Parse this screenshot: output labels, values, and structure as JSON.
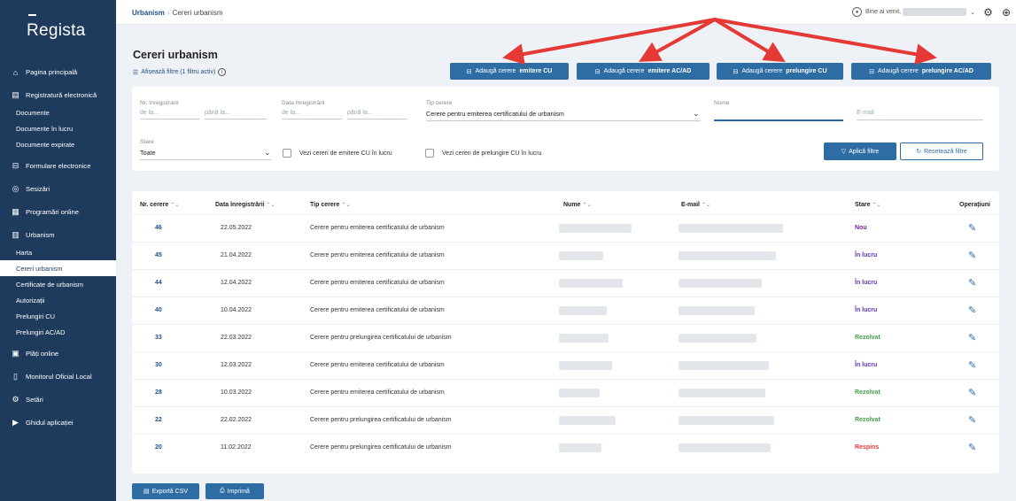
{
  "app": {
    "logo": "Regista"
  },
  "sidebar": {
    "items": [
      {
        "label": "Pagina principală",
        "icon": "home-icon"
      },
      {
        "label": "Registratură electronică",
        "icon": "document-icon"
      },
      {
        "label": "Documente",
        "icon": ""
      },
      {
        "label": "Documente în lucru",
        "icon": ""
      },
      {
        "label": "Documente expirate",
        "icon": ""
      },
      {
        "label": "Formulare electronice",
        "icon": "form-icon"
      },
      {
        "label": "Sesizări",
        "icon": "location-pin-icon"
      },
      {
        "label": "Programări online",
        "icon": "calendar-icon"
      },
      {
        "label": "Urbanism",
        "icon": "building-icon"
      },
      {
        "label": "Harta",
        "icon": ""
      },
      {
        "label": "Cereri urbanism",
        "icon": ""
      },
      {
        "label": "Certificate de urbanism",
        "icon": ""
      },
      {
        "label": "Autorizații",
        "icon": ""
      },
      {
        "label": "Prelungiri CU",
        "icon": ""
      },
      {
        "label": "Prelungiri AC/AD",
        "icon": ""
      },
      {
        "label": "Plăți online",
        "icon": "payment-icon"
      },
      {
        "label": "Monitorul Oficial Local",
        "icon": "monitor-icon"
      },
      {
        "label": "Setări",
        "icon": "settings-icon"
      },
      {
        "label": "Ghidul aplicației",
        "icon": "play-circle-icon"
      }
    ]
  },
  "topbar": {
    "breadcrumb_root": "Urbanism",
    "breadcrumb_current": "Cereri urbanism",
    "greeting": "Bine ai venit,"
  },
  "header": {
    "title": "Cereri urbanism",
    "filter_toggle": "Afișează filtre (1 filtru activ)"
  },
  "actions": {
    "b1_prefix": "Adaugă cerere ",
    "b1_bold": "emitere CU",
    "b2_prefix": "Adaugă cerere ",
    "b2_bold": "emitere AC/AD",
    "b3_prefix": "Adaugă cerere ",
    "b3_bold": "prelungire CU",
    "b4_prefix": "Adaugă cerere ",
    "b4_bold": "prelungire AC/AD"
  },
  "filters": {
    "nr_label": "Nr. înregistrare",
    "nr_from": "de la...",
    "nr_to": "până la...",
    "date_label": "Data înregistrării",
    "date_from": "de la...",
    "date_to": "până la...",
    "type_label": "Tip cerere",
    "type_value": "Cerere pentru emiterea certificatului de urbanism",
    "name_label": "Nume",
    "email_placeholder": "E-mail",
    "status_label": "Stare",
    "status_value": "Toate",
    "cb1": "Vezi cereri de emitere CU în lucru",
    "cb2": "Vezi cereri de prelungire CU în lucru",
    "apply": "Aplică filtre",
    "reset": "Resetează filtre"
  },
  "table": {
    "columns": {
      "nr": "Nr. cerere",
      "date": "Data înregistrării",
      "type": "Tip cerere",
      "name": "Nume",
      "email": "E-mail",
      "status": "Stare",
      "ops": "Operațiuni"
    },
    "rows": [
      {
        "nr": "46",
        "date": "22.05.2022",
        "type": "Cerere pentru emiterea certificatului de urbanism",
        "status": "Nou"
      },
      {
        "nr": "45",
        "date": "21.04.2022",
        "type": "Cerere pentru emiterea certificatului de urbanism",
        "status": "În lucru"
      },
      {
        "nr": "44",
        "date": "12.04.2022",
        "type": "Cerere pentru emiterea certificatului de urbanism",
        "status": "În lucru"
      },
      {
        "nr": "40",
        "date": "10.04.2022",
        "type": "Cerere pentru emiterea certificatului de urbanism",
        "status": "În lucru"
      },
      {
        "nr": "33",
        "date": "22.03.2022",
        "type": "Cerere pentru prelungirea certificatului de urbanism",
        "status": "Rezolvat"
      },
      {
        "nr": "30",
        "date": "12.03.2022",
        "type": "Cerere pentru emiterea certificatului de urbanism",
        "status": "În lucru"
      },
      {
        "nr": "28",
        "date": "10.03.2022",
        "type": "Cerere pentru emiterea certificatului de urbanism",
        "status": "Rezolvat"
      },
      {
        "nr": "22",
        "date": "22.02.2022",
        "type": "Cerere pentru prelungirea certificatului de urbanism",
        "status": "Rezolvat"
      },
      {
        "nr": "20",
        "date": "11.02.2022",
        "type": "Cerere pentru prelungirea certificatului de urbanism",
        "status": "Respins"
      }
    ]
  },
  "status_colors": {
    "Nou": "#7b1fa2",
    "În lucru": "#5e35b1",
    "Rezolvat": "#43a047",
    "Respins": "#e53935"
  },
  "footer": {
    "export": "Exportă CSV",
    "print": "Imprimă"
  },
  "colors": {
    "sidebar": "#1e3a5c",
    "accent": "#2e6da4",
    "annotation_arrow": "#e53935"
  }
}
